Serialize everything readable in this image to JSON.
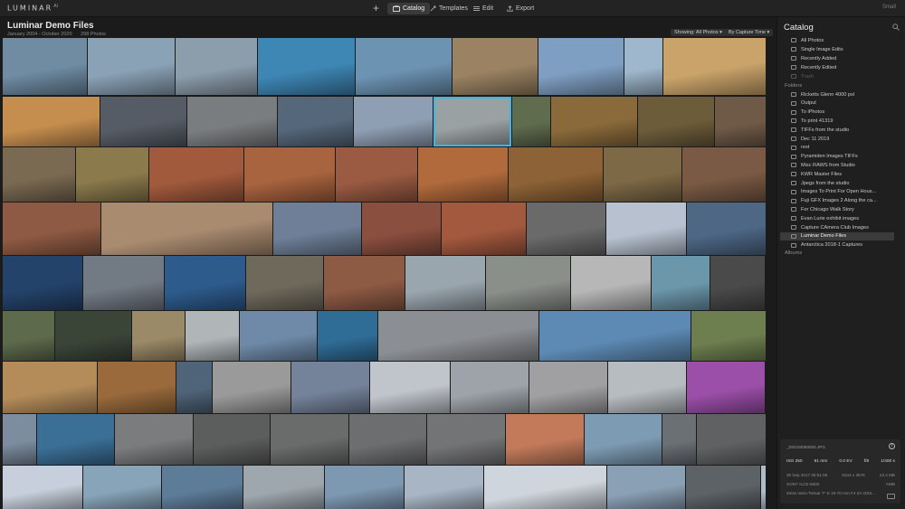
{
  "app": {
    "logo": "LUMINAR",
    "logo_sup": "AI"
  },
  "topbar": {
    "add_label": "+",
    "tabs": [
      {
        "label": "Catalog",
        "icon": "catalog-icon",
        "active": true
      },
      {
        "label": "Templates",
        "icon": "templates-icon",
        "active": false
      },
      {
        "label": "Edit",
        "icon": "sliders-icon",
        "active": false
      },
      {
        "label": "Export",
        "icon": "export-icon",
        "active": false
      }
    ],
    "size_label": "Small"
  },
  "gallery": {
    "title": "Luminar Demo Files",
    "date_range": "January 2004 - October 2020",
    "photo_count": "298 Photos",
    "showing": "Showing: All Photos",
    "sort": "By Capture Time"
  },
  "sidebar": {
    "title": "Catalog",
    "shortcuts": [
      {
        "label": "All Photos",
        "dim": false
      },
      {
        "label": "Single Image Edits",
        "dim": false
      },
      {
        "label": "Recently Added",
        "dim": false
      },
      {
        "label": "Recently Edited",
        "dim": false
      },
      {
        "label": "Trash",
        "dim": true
      }
    ],
    "folders_label": "Folders",
    "folders": [
      {
        "label": "Ricketts Glenn 4000 pxl",
        "active": false
      },
      {
        "label": "Output",
        "active": false
      },
      {
        "label": "To iPhotos",
        "active": false
      },
      {
        "label": "To print 41319",
        "active": false
      },
      {
        "label": "TIFFs from the studio",
        "active": false
      },
      {
        "label": "Dec 11 2019",
        "active": false
      },
      {
        "label": "rest",
        "active": false
      },
      {
        "label": "Pyramiden Images TIFFs",
        "active": false
      },
      {
        "label": "Misc RAWS from Studio",
        "active": false
      },
      {
        "label": "KWR Master Files",
        "active": false
      },
      {
        "label": "Jpegs from the studio",
        "active": false
      },
      {
        "label": "Images To Print For Open Hous...",
        "active": false
      },
      {
        "label": "Fuji GFX Images 2 Along the ca...",
        "active": false
      },
      {
        "label": "For Chicago Walk Story",
        "active": false
      },
      {
        "label": "Evan Lurie exhibit images",
        "active": false
      },
      {
        "label": "Capture CAmera Club Images",
        "active": false
      },
      {
        "label": "Luminar Demo Files",
        "active": true
      },
      {
        "label": "Antarctica 2018-1 Captures",
        "active": false
      }
    ],
    "albums_label": "Albums"
  },
  "info": {
    "filename": "_DSC63050004.JPG",
    "info_icon": "info-icon",
    "iso": "ISO 250",
    "focal": "61 mm",
    "ev": "0.0 EV",
    "aperture": "f/8",
    "shutter": "1/400 s",
    "date": "30 Sep 2017 05:51:06",
    "dimensions": "5344 x 3576",
    "filesize": "23.4 MB",
    "camera": "SONY ILCE-6500",
    "wb": "AWB",
    "lens": "Zeiss Vario-Tessar T* E 16-70 mm F4 ZA OSS..."
  },
  "thumb_rows": [
    {
      "colors": [
        "#6f8ca3",
        "#8aa2b5",
        "#8c9dac",
        "#3e86b4",
        "#6d93b3",
        "#9a8262",
        "#7f9fc2",
        "#9eb7cc",
        "#c9a36a"
      ],
      "widths": [
        93,
        96,
        90,
        107,
        106,
        94,
        94,
        42,
        116
      ]
    },
    {
      "colors": [
        "#c58d4e",
        "#565c66",
        "#7a7d7f",
        "#55677a",
        "#8f9fb3",
        "#9aa1a3",
        "#5f6c4e",
        "#8a6a3b",
        "#6c5c3a",
        "#6f5a48"
      ],
      "widths": [
        107,
        95,
        99,
        83,
        87,
        86,
        42,
        95,
        84,
        60
      ]
    },
    {
      "colors": [
        "#7a6a52",
        "#8a7a4c",
        "#a25a3c",
        "#a8633f",
        "#9b5b43",
        "#b06a3c",
        "#8d6236",
        "#7e6946",
        "#7a5a44"
      ],
      "widths": [
        80,
        80,
        104,
        100,
        90,
        99,
        104,
        86,
        93
      ]
    },
    {
      "colors": [
        "#8f5a43",
        "#a98b70",
        "#6e7f97",
        "#8b4f3f",
        "#a3593e",
        "#6a6a6a",
        "#b7c1cf",
        "#4d6785"
      ],
      "widths": [
        108,
        189,
        97,
        87,
        93,
        87,
        88,
        87
      ]
    },
    {
      "colors": [
        "#24436b",
        "#727a84",
        "#2d5b8c",
        "#6f695c",
        "#8d5a44",
        "#9aa6ae",
        "#8b8f8a",
        "#b7b7b7",
        "#6c97ab",
        "#4a4a4a"
      ],
      "widths": [
        88,
        89,
        89,
        85,
        89,
        88,
        93,
        88,
        64,
        60
      ]
    },
    {
      "colors": [
        "#5d6b4c",
        "#3a4538",
        "#9b8a68",
        "#b0b5b7",
        "#6e8aa8",
        "#2f6c96",
        "#8b8e92",
        "#5d8ab4",
        "#6d7f4f"
      ],
      "widths": [
        57,
        84,
        58,
        59,
        85,
        66,
        177,
        167,
        84
      ]
    },
    {
      "colors": [
        "#b48c5a",
        "#9a6a3c",
        "#4f6478",
        "#9a9a9a",
        "#74829a",
        "#c0c4cb",
        "#9da3a8",
        "#a0a0a2",
        "#b7bcc0",
        "#9b4fa8"
      ],
      "widths": [
        104,
        86,
        39,
        86,
        86,
        88,
        86,
        86,
        86,
        86
      ]
    },
    {
      "colors": [
        "#7c8da0",
        "#3b6f96",
        "#7a7c7e",
        "#5c5d5d",
        "#6a6b6b",
        "#6d6e6f",
        "#737475",
        "#c27a5a",
        "#7d9bb3",
        "#6b7075",
        "#5f6163"
      ],
      "widths": [
        37,
        85,
        86,
        84,
        86,
        85,
        86,
        86,
        85,
        37,
        84
      ]
    },
    {
      "colors": [
        "#c6cfdb",
        "#87a4b8",
        "#5d7c98",
        "#9ea7ae",
        "#7d98b1",
        "#a7b5c4",
        "#cfd5dc",
        "#8aa0b5",
        "#5d6266",
        "#b0bdc8"
      ],
      "widths": [
        88,
        86,
        89,
        89,
        87,
        87,
        135,
        86,
        82,
        28
      ]
    }
  ]
}
